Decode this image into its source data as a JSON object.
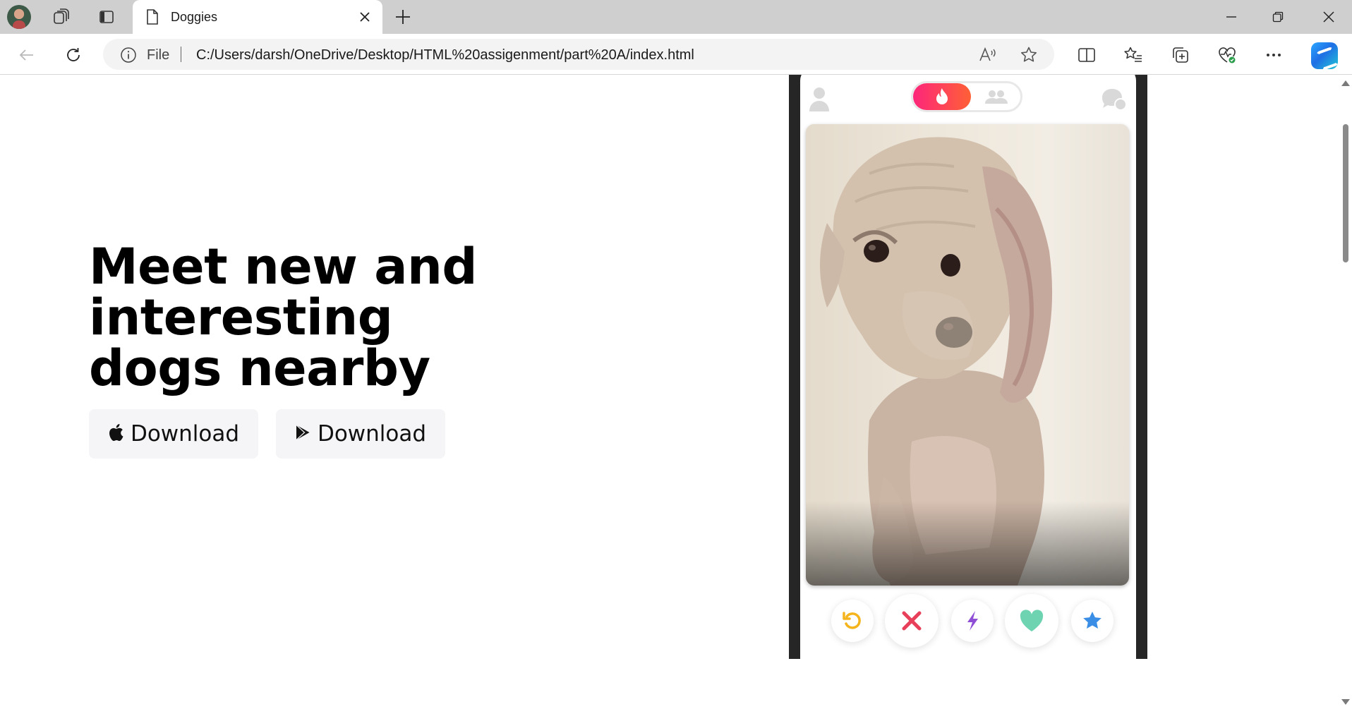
{
  "browser": {
    "tab_title": "Doggies",
    "address_prefix": "File",
    "url": "C:/Users/darsh/OneDrive/Desktop/HTML%20assigenment/part%20A/index.html"
  },
  "hero": {
    "headline": "Meet new and interesting dogs nearby",
    "apple_button_label": "Download",
    "play_button_label": "Download"
  },
  "phone": {
    "photo_description_icon": "dog-photo",
    "actions": [
      "rewind-icon",
      "nope-icon",
      "boost-icon",
      "like-icon",
      "super-like-icon"
    ],
    "colors": {
      "toggle_gradient_start": "#fd267a",
      "toggle_gradient_end": "#ff6036",
      "rewind": "#f5b41b",
      "nope": "#e8405a",
      "boost": "#8e4fd6",
      "like": "#6dd3b1",
      "super_like": "#3b8ee5"
    }
  }
}
